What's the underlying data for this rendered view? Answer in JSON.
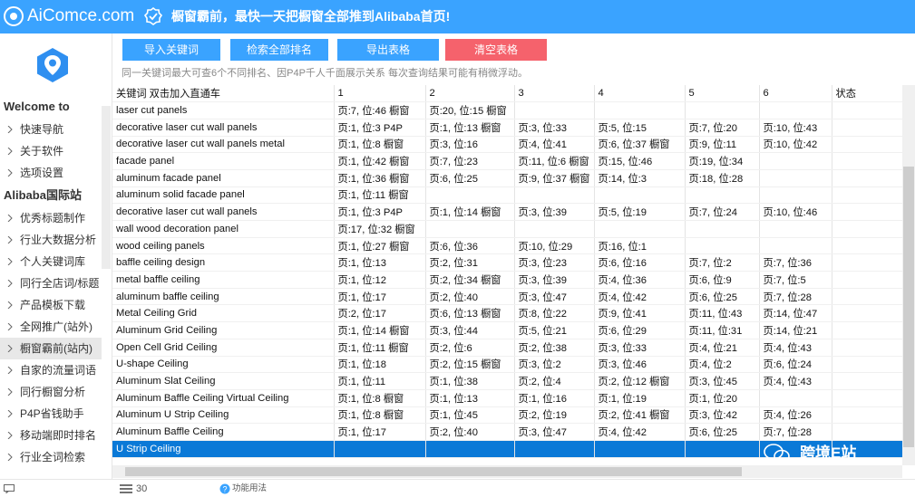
{
  "app": {
    "brand": "AiComce.com",
    "slogan": "橱窗霸前，最快一天把橱窗全部推到Alibaba首页!"
  },
  "sidebar": {
    "welcome": "Welcome to",
    "group1": [
      {
        "label": "快速导航"
      },
      {
        "label": "关于软件"
      },
      {
        "label": "选项设置"
      }
    ],
    "section2": "Alibaba国际站",
    "group2": [
      {
        "label": "优秀标题制作"
      },
      {
        "label": "行业大数据分析"
      },
      {
        "label": "个人关键词库"
      },
      {
        "label": "同行全店词/标题"
      },
      {
        "label": "产品模板下载"
      },
      {
        "label": "全网推广(站外)"
      },
      {
        "label": "橱窗霸前(站内)"
      },
      {
        "label": "自家的流量词语"
      },
      {
        "label": "同行橱窗分析"
      },
      {
        "label": "P4P省钱助手"
      },
      {
        "label": "移动端即时排名"
      },
      {
        "label": "行业全词检索"
      }
    ]
  },
  "toolbar": {
    "import": "导入关键词",
    "search": "检索全部排名",
    "export": "导出表格",
    "clear": "清空表格"
  },
  "notice": "同一关键词最大可查6个不同排名、因P4P千人千面展示关系 每次查询结果可能有稍微浮动。",
  "table": {
    "headers": [
      "关键词 双击加入直通车",
      "1",
      "2",
      "3",
      "4",
      "5",
      "6",
      "状态"
    ],
    "rows": [
      [
        "laser cut panels",
        "页:7, 位:46 橱窗",
        "页:20, 位:15 橱窗",
        "",
        "",
        "",
        "",
        ""
      ],
      [
        "decorative laser cut wall panels",
        "页:1, 位:3 P4P",
        "页:1, 位:13 橱窗",
        "页:3, 位:33",
        "页:5, 位:15",
        "页:7, 位:20",
        "页:10, 位:43",
        ""
      ],
      [
        "decorative laser cut wall panels metal",
        "页:1, 位:8 橱窗",
        "页:3, 位:16",
        "页:4, 位:41",
        "页:6, 位:37 橱窗",
        "页:9, 位:11",
        "页:10, 位:42",
        ""
      ],
      [
        "facade panel",
        "页:1, 位:42 橱窗",
        "页:7, 位:23",
        "页:11, 位:6 橱窗",
        "页:15, 位:46",
        "页:19, 位:34",
        "",
        ""
      ],
      [
        "aluminum facade panel",
        "页:1, 位:36 橱窗",
        "页:6, 位:25",
        "页:9, 位:37 橱窗",
        "页:14, 位:3",
        "页:18, 位:28",
        "",
        ""
      ],
      [
        "aluminum solid facade panel",
        "页:1, 位:11 橱窗",
        "",
        "",
        "",
        "",
        "",
        ""
      ],
      [
        "decorative laser cut wall panels",
        "页:1, 位:3 P4P",
        "页:1, 位:14 橱窗",
        "页:3, 位:39",
        "页:5, 位:19",
        "页:7, 位:24",
        "页:10, 位:46",
        ""
      ],
      [
        "wall wood decoration panel",
        "页:17, 位:32 橱窗",
        "",
        "",
        "",
        "",
        "",
        ""
      ],
      [
        "wood ceiling panels",
        "页:1, 位:27 橱窗",
        "页:6, 位:36",
        "页:10, 位:29",
        "页:16, 位:1",
        "",
        "",
        ""
      ],
      [
        "baffle ceiling design",
        "页:1, 位:13",
        "页:2, 位:31",
        "页:3, 位:23",
        "页:6, 位:16",
        "页:7, 位:2",
        "页:7, 位:36",
        ""
      ],
      [
        "metal baffle ceiling",
        "页:1, 位:12",
        "页:2, 位:34 橱窗",
        "页:3, 位:39",
        "页:4, 位:36",
        "页:6, 位:9",
        "页:7, 位:5",
        ""
      ],
      [
        "aluminum baffle ceiling",
        "页:1, 位:17",
        "页:2, 位:40",
        "页:3, 位:47",
        "页:4, 位:42",
        "页:6, 位:25",
        "页:7, 位:28",
        ""
      ],
      [
        "Metal Ceiling Grid",
        "页:2, 位:17",
        "页:6, 位:13 橱窗",
        "页:8, 位:22",
        "页:9, 位:41",
        "页:11, 位:43",
        "页:14, 位:47",
        ""
      ],
      [
        "Aluminum Grid Ceiling",
        "页:1, 位:14 橱窗",
        "页:3, 位:44",
        "页:5, 位:21",
        "页:6, 位:29",
        "页:11, 位:31",
        "页:14, 位:21",
        ""
      ],
      [
        "Open Cell Grid Ceiling",
        "页:1, 位:11 橱窗",
        "页:2, 位:6",
        "页:2, 位:38",
        "页:3, 位:33",
        "页:4, 位:21",
        "页:4, 位:43",
        ""
      ],
      [
        "U-shape Ceiling",
        "页:1, 位:18",
        "页:2, 位:15 橱窗",
        "页:3, 位:2",
        "页:3, 位:46",
        "页:4, 位:2",
        "页:6, 位:24",
        ""
      ],
      [
        "Aluminum Slat Ceiling",
        "页:1, 位:11",
        "页:1, 位:38",
        "页:2, 位:4",
        "页:2, 位:12 橱窗",
        "页:3, 位:45",
        "页:4, 位:43",
        ""
      ],
      [
        "Aluminum Baffle Ceiling Virtual Ceiling",
        "页:1, 位:8 橱窗",
        "页:1, 位:13",
        "页:1, 位:16",
        "页:1, 位:19",
        "页:1, 位:20",
        "",
        ""
      ],
      [
        "Aluminum U Strip Ceiling",
        "页:1, 位:8 橱窗",
        "页:1, 位:45",
        "页:2, 位:19",
        "页:2, 位:41 橱窗",
        "页:3, 位:42",
        "页:4, 位:26",
        ""
      ],
      [
        "Aluminum Baffle Ceiling",
        "页:1, 位:17",
        "页:2, 位:40",
        "页:3, 位:47",
        "页:4, 位:42",
        "页:6, 位:25",
        "页:7, 位:28",
        ""
      ],
      [
        "U Strip Ceiling",
        "",
        "",
        "",
        "",
        "",
        "",
        ""
      ]
    ]
  },
  "status": {
    "count": "30",
    "help": "功能用法"
  },
  "watermark": "跨境E站",
  "colors": {
    "accent": "#3aa3ff",
    "danger": "#f5626c",
    "selection": "#0a79d7"
  },
  "icons": [
    "logo-icon",
    "check-badge-icon",
    "minimize-icon",
    "maximize-icon",
    "close-icon",
    "location-pin-icon",
    "chevron-right-icon",
    "menu-icon",
    "help-icon",
    "chat-icon",
    "wechat-icon"
  ]
}
